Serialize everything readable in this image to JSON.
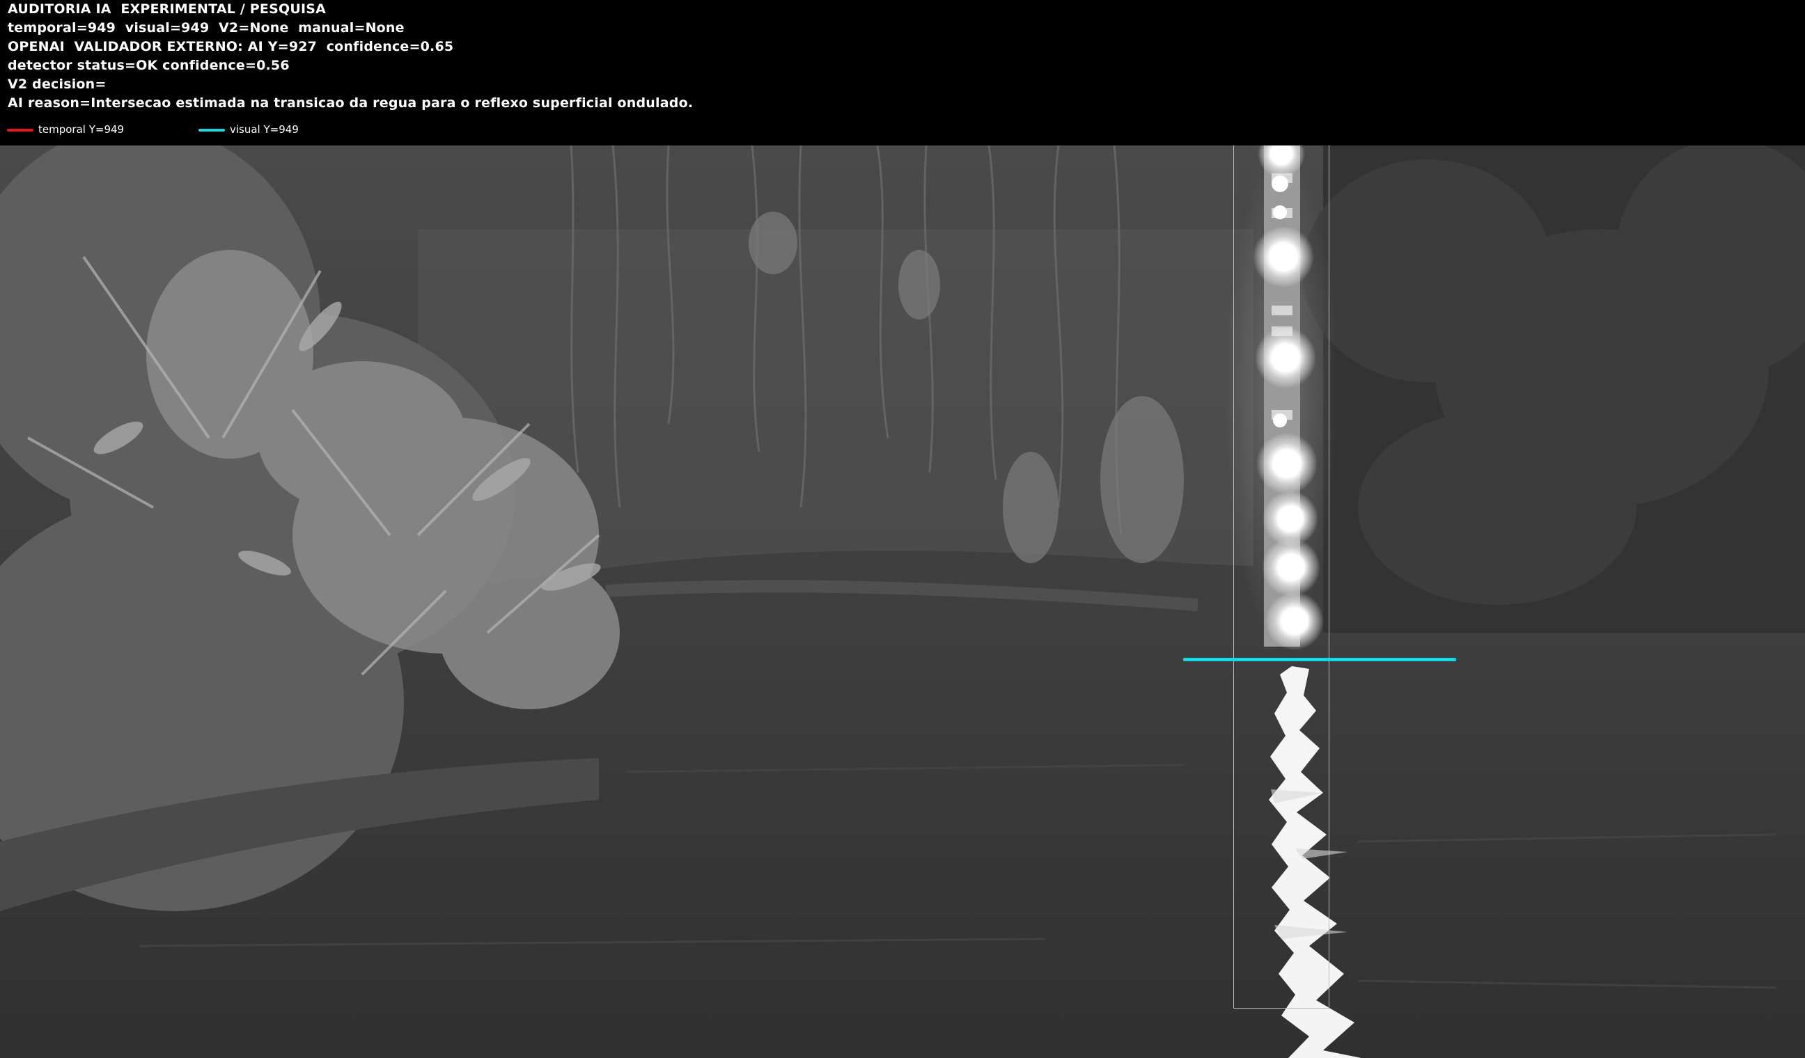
{
  "overlay": {
    "lines": [
      "AUDITORIA IA  EXPERIMENTAL / PESQUISA",
      "temporal=949  visual=949  V2=None  manual=None",
      "OPENAI  VALIDADOR EXTERNO: AI Y=927  confidence=0.65",
      "detector status=OK confidence=0.56",
      "V2 decision=",
      "AI reason=Intersecao estimada na transicao da regua para o reflexo superficial ondulado."
    ],
    "legend": [
      {
        "label": "temporal Y=949",
        "color": "#e8141c"
      },
      {
        "label": "visual Y=949",
        "color": "#19d6e0"
      }
    ]
  },
  "colors": {
    "header_background": "#000000",
    "visual_line": "#19d6e0",
    "roi_box": "#b9b9b9"
  }
}
